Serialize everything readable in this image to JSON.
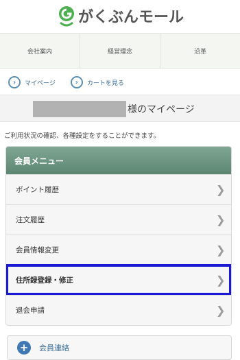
{
  "brand": {
    "logo_text": "がくぶんモール",
    "accent": "#4caf50"
  },
  "topnav": {
    "items": [
      {
        "label": "会社案内"
      },
      {
        "label": "経営理念"
      },
      {
        "label": "沿革"
      }
    ]
  },
  "quicklinks": {
    "mypage": "マイページ",
    "cart": "カートを見る",
    "icon": "chevron-right-icon"
  },
  "title": {
    "suffix": "様のマイページ"
  },
  "intro": "ご利用状況の確認、各種設定をすることができます。",
  "menu": {
    "header": "会員メニュー",
    "items": [
      {
        "label": "ポイント履歴"
      },
      {
        "label": "注文履歴"
      },
      {
        "label": "会員情報変更"
      },
      {
        "label": "住所録登録・修正"
      },
      {
        "label": "退会申請"
      }
    ],
    "selected_index": 3,
    "selection_color": "#1a1ad4"
  },
  "contact": {
    "label": "会員連絡",
    "icon": "plus-icon"
  }
}
